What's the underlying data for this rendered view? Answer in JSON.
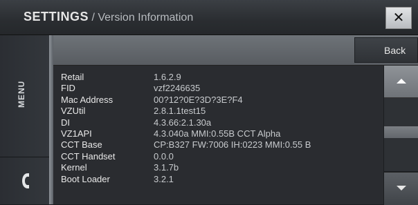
{
  "header": {
    "title_main": "SETTINGS",
    "title_sep": " / ",
    "title_sub": "Version Information",
    "close_label": "✕"
  },
  "rail": {
    "menu_label": "MENU",
    "phone_icon": "phone-handset-icon"
  },
  "toolbar": {
    "back_label": "Back"
  },
  "info": {
    "rows": [
      {
        "label": "Retail",
        "value": "1.6.2.9"
      },
      {
        "label": "FID",
        "value": "vzf2246635"
      },
      {
        "label": "Mac Address",
        "value": "00?12?0E?3D?3E?F4"
      },
      {
        "label": "VZUtil",
        "value": "2.8.1.1test15"
      },
      {
        "label": "DI",
        "value": "4.3.66:2.1.30a"
      },
      {
        "label": "VZ1API",
        "value": "4.3.040a MMI:0.55B CCT Alpha"
      },
      {
        "label": "CCT Base",
        "value": "CP:B327 FW:7006 IH:0223 MMI:0.55 B"
      },
      {
        "label": "CCT Handset",
        "value": "0.0.0"
      },
      {
        "label": "Kernel",
        "value": "3.1.7b"
      },
      {
        "label": "Boot Loader",
        "value": "3.2.1"
      }
    ]
  },
  "colors": {
    "background": "#1b1d20",
    "header": "#2a2d31",
    "accent_bar": "#6e7378"
  }
}
